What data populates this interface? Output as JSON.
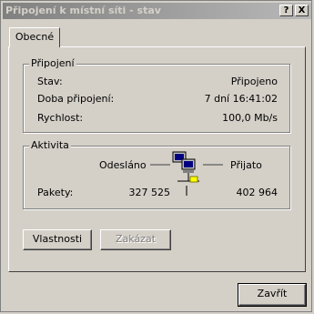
{
  "window": {
    "title": "Připojení k místní síti - stav",
    "help_label": "?",
    "close_label": "X"
  },
  "tabs": [
    {
      "label": "Obecné"
    }
  ],
  "connection": {
    "title": "Připojení",
    "rows": [
      {
        "label": "Stav:",
        "value": "Připojeno"
      },
      {
        "label": "Doba připojení:",
        "value": "7 dní 16:41:02"
      },
      {
        "label": "Rychlost:",
        "value": "100,0 Mb/s"
      }
    ]
  },
  "activity": {
    "title": "Aktivita",
    "sent_label": "Odesláno",
    "received_label": "Přijato",
    "packets_label": "Pakety:",
    "packets_sent": "327 525",
    "packets_received": "402 964"
  },
  "buttons": {
    "properties": "Vlastnosti",
    "disable": "Zakázat",
    "close": "Zavřít"
  }
}
